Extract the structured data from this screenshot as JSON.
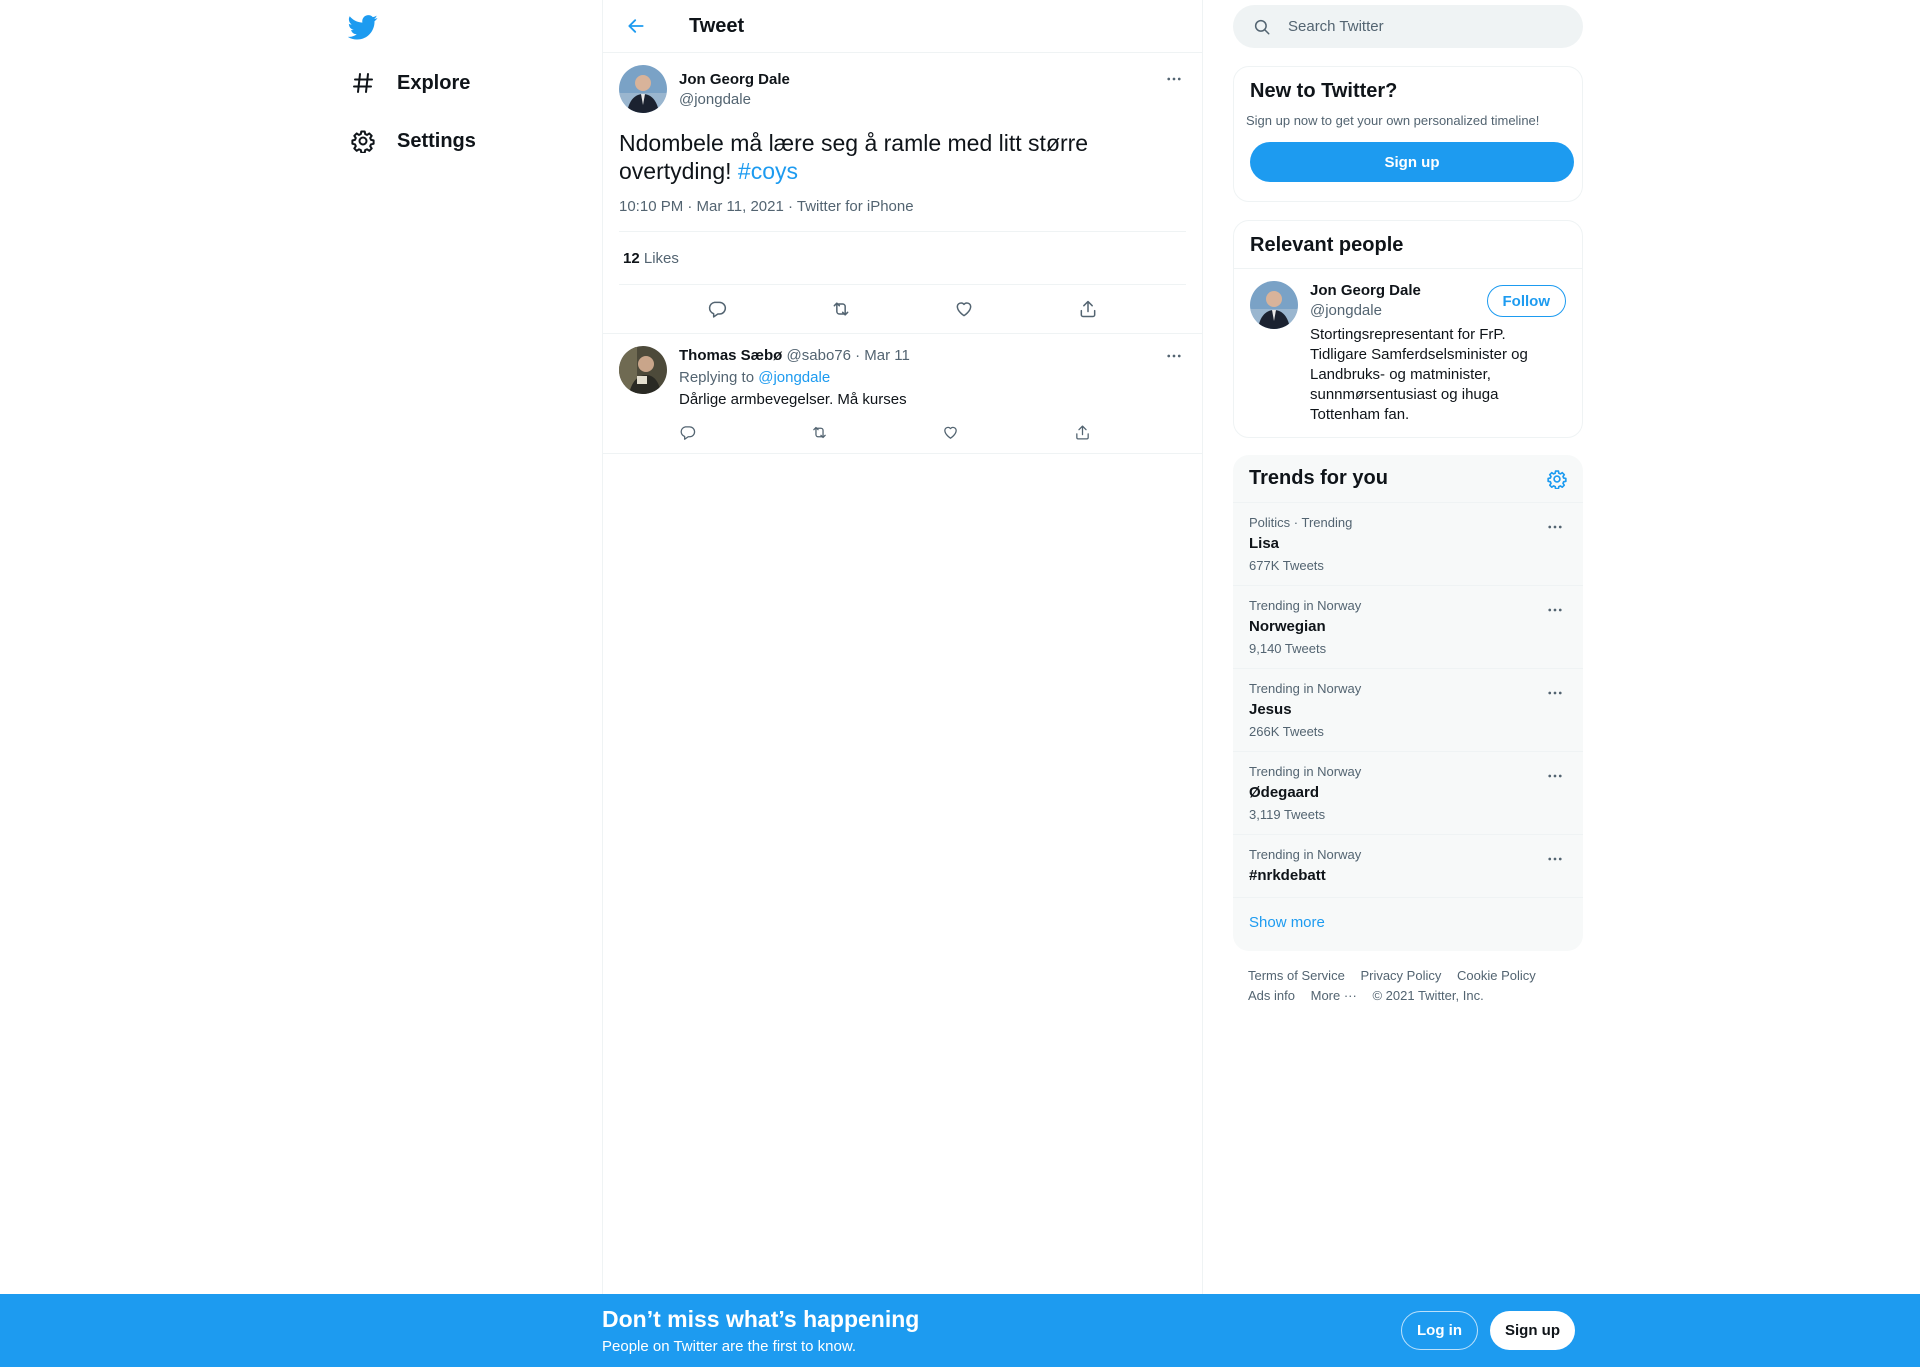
{
  "nav": {
    "logo": "twitter-bird-icon",
    "items": [
      {
        "label": "Explore",
        "icon": "hashtag-icon"
      },
      {
        "label": "Settings",
        "icon": "gear-icon"
      }
    ]
  },
  "main": {
    "header_title": "Tweet",
    "tweet": {
      "author_name": "Jon Georg Dale",
      "author_handle": "@jongdale",
      "text_main": "Ndombele må lære seg å ramle med litt større overtyding! ",
      "hashtag": "#coys",
      "meta": "10:10 PM · Mar 11, 2021 · Twitter for iPhone",
      "likes_count": "12",
      "likes_label": "Likes"
    },
    "reply": {
      "author_name": "Thomas Sæbø",
      "handle_date": "@sabo76 · Mar 11",
      "replying_label": "Replying to ",
      "replying_handle": "@jongdale",
      "text": "Dårlige armbevegelser. Må kurses"
    }
  },
  "right": {
    "search_placeholder": "Search Twitter",
    "new_to_twitter": {
      "title": "New to Twitter?",
      "subtitle": "Sign up now to get your own personalized timeline!",
      "button": "Sign up"
    },
    "relevant_people": {
      "title": "Relevant people",
      "person": {
        "name": "Jon Georg Dale",
        "handle": "@jongdale",
        "bio": "Stortingsrepresentant for FrP. Tidligare Samferdselsminister og Landbruks- og matminister, sunnmørsentusiast og ihuga Tottenham fan.",
        "follow_label": "Follow"
      }
    },
    "trends": {
      "title": "Trends for you",
      "items": [
        {
          "context": "Politics · Trending",
          "name": "Lisa",
          "count": "677K Tweets"
        },
        {
          "context": "Trending in Norway",
          "name": "Norwegian",
          "count": "9,140 Tweets"
        },
        {
          "context": "Trending in Norway",
          "name": "Jesus",
          "count": "266K Tweets"
        },
        {
          "context": "Trending in Norway",
          "name": "Ødegaard",
          "count": "3,119 Tweets"
        },
        {
          "context": "Trending in Norway",
          "name": "#nrkdebatt",
          "count": ""
        }
      ],
      "show_more": "Show more"
    },
    "footer": {
      "links": [
        "Terms of Service",
        "Privacy Policy",
        "Cookie Policy",
        "Ads info",
        "More ···",
        "© 2021 Twitter, Inc."
      ]
    }
  },
  "bottom_bar": {
    "title": "Don’t miss what’s happening",
    "subtitle": "People on Twitter are the first to know.",
    "login": "Log in",
    "signup": "Sign up"
  },
  "colors": {
    "accent": "#1d9bf0",
    "text": "#0f1419",
    "muted": "#536471"
  }
}
